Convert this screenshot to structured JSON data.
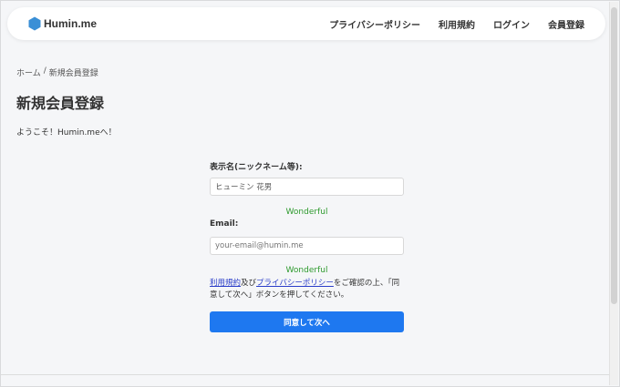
{
  "header": {
    "brand": "Humin.me",
    "brand_color": "#3a8fd6",
    "nav": [
      "プライバシーポリシー",
      "利用規約",
      "ログイン",
      "会員登録"
    ]
  },
  "breadcrumb": {
    "home": "ホーム",
    "separator": "/",
    "current": "新規会員登録"
  },
  "page": {
    "title": "新規会員登録",
    "welcome": "ようこそ！Humin.meへ！"
  },
  "form": {
    "display_name_label": "表示名(ニックネーム等):",
    "display_name_value": "ヒューミン 花男",
    "display_name_feedback": "Wonderful",
    "email_label": "Email:",
    "email_placeholder": "your-email@humin.me",
    "email_feedback": "Wonderful",
    "terms_link": "利用規約",
    "terms_and": "及び",
    "privacy_link": "プライバシーポリシー",
    "terms_text": "をご確認の上、「同意して次へ」ボタンを押してください。",
    "submit_label": "同意して次へ",
    "valid_color": "#2e9a2e",
    "button_color": "#1e78f0"
  }
}
